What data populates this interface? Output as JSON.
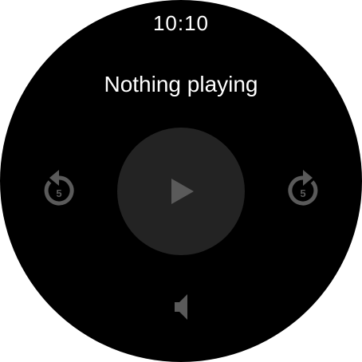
{
  "status": {
    "time": "10:10"
  },
  "player": {
    "title": "Nothing playing",
    "skip_back_seconds": "5",
    "skip_forward_seconds": "5"
  },
  "icons": {
    "play": "play-icon",
    "skip_back": "replay-5-icon",
    "skip_forward": "forward-5-icon",
    "volume": "volume-icon"
  },
  "colors": {
    "background": "#000000",
    "text": "#ffffff",
    "control_disabled": "#5a5a5a",
    "play_circle": "#232323"
  }
}
